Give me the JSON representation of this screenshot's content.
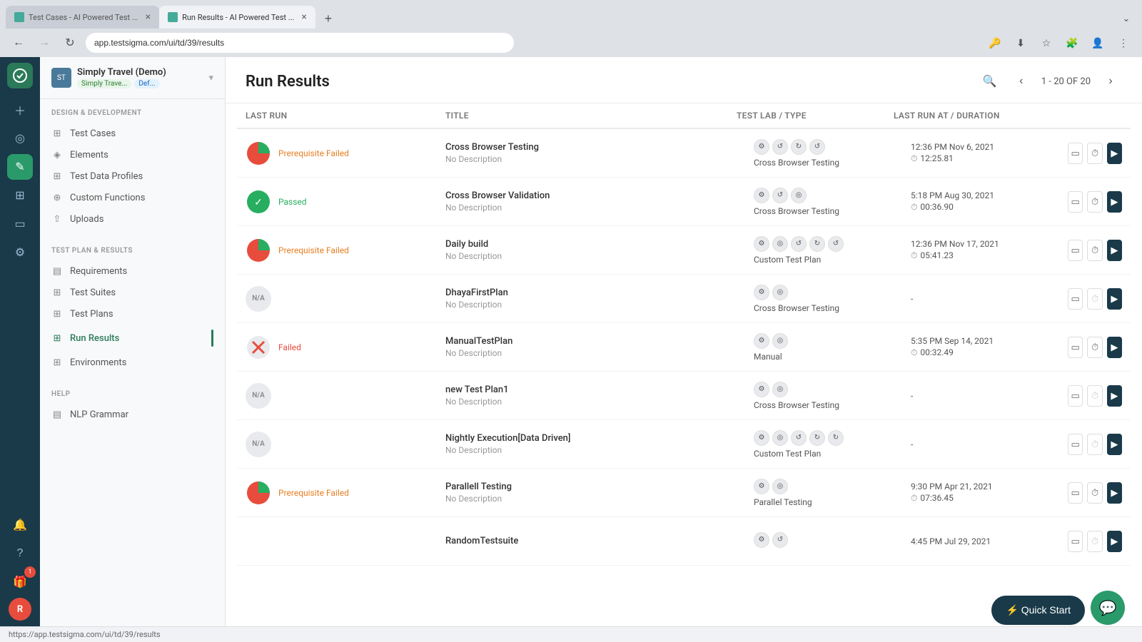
{
  "browser": {
    "tabs": [
      {
        "id": "tab1",
        "label": "Test Cases - AI Powered Test ...",
        "active": false,
        "icon_color": "#4a9a6a"
      },
      {
        "id": "tab2",
        "label": "Run Results - AI Powered Test ...",
        "active": true,
        "icon_color": "#4a9a6a"
      }
    ],
    "new_tab_label": "+",
    "address": "app.testsigma.com/ui/td/39/results",
    "back_disabled": false,
    "forward_disabled": true
  },
  "rail": {
    "logo": "T",
    "buttons": [
      {
        "id": "add",
        "icon": "➕",
        "active": false
      },
      {
        "id": "eye",
        "icon": "◎",
        "active": false
      },
      {
        "id": "edit",
        "icon": "✏",
        "active": true,
        "style": "green"
      },
      {
        "id": "briefcase",
        "icon": "💼",
        "active": false
      },
      {
        "id": "monitor",
        "icon": "⬜",
        "active": false
      },
      {
        "id": "settings",
        "icon": "⚙",
        "active": false
      },
      {
        "id": "bell",
        "icon": "🔔",
        "active": false
      },
      {
        "id": "help",
        "icon": "❓",
        "active": false
      },
      {
        "id": "gift",
        "icon": "🎁",
        "badge": "1"
      }
    ],
    "avatar_label": "R"
  },
  "sidebar": {
    "org_name": "Simply Travel (Demo)",
    "org_sub1": "Simply Trave...",
    "org_sub2": "Def...",
    "sections": [
      {
        "label": "DESIGN & DEVELOPMENT",
        "items": [
          {
            "id": "test-cases",
            "label": "Test Cases",
            "icon": "▦",
            "active": false
          },
          {
            "id": "elements",
            "label": "Elements",
            "icon": "◈",
            "active": false
          },
          {
            "id": "test-data-profiles",
            "label": "Test Data Profiles",
            "icon": "⊞",
            "active": false
          },
          {
            "id": "custom-functions",
            "label": "Custom Functions",
            "icon": "⊕",
            "active": false
          },
          {
            "id": "uploads",
            "label": "Uploads",
            "icon": "⇧",
            "active": false
          }
        ]
      },
      {
        "label": "TEST PLAN & RESULTS",
        "items": [
          {
            "id": "requirements",
            "label": "Requirements",
            "icon": "▤",
            "active": false
          },
          {
            "id": "test-suites",
            "label": "Test Suites",
            "icon": "▦",
            "active": false
          },
          {
            "id": "test-plans",
            "label": "Test Plans",
            "icon": "▦",
            "active": false
          },
          {
            "id": "run-results",
            "label": "Run Results",
            "icon": "▦",
            "active": true
          },
          {
            "id": "environments",
            "label": "Environments",
            "icon": "▦",
            "active": false
          }
        ]
      },
      {
        "label": "HELP",
        "items": [
          {
            "id": "nlp-grammar",
            "label": "NLP Grammar",
            "icon": "▤",
            "active": false
          }
        ]
      }
    ]
  },
  "main": {
    "title": "Run Results",
    "pagination": "1 - 20 OF 20",
    "table_headers": [
      "Last Run",
      "Title",
      "Test Lab / Type",
      "Last Run At / Duration",
      ""
    ],
    "rows": [
      {
        "id": "row1",
        "status_type": "pie",
        "status_label": "Prerequisite Failed",
        "status_color": "#e67e22",
        "title": "Cross Browser Testing",
        "description": "No Description",
        "lab_icons": [
          "⚙",
          "↺",
          "↻",
          "↺"
        ],
        "lab_type": "Cross Browser Testing",
        "time_date": "12:36 PM Nov 6, 2021",
        "duration": "12:25.81",
        "has_duration": true
      },
      {
        "id": "row2",
        "status_type": "passed",
        "status_label": "Passed",
        "status_color": "#27ae60",
        "title": "Cross Browser Validation",
        "description": "No Description",
        "lab_icons": [
          "⚙",
          "↺",
          "◎"
        ],
        "lab_type": "Cross Browser Testing",
        "time_date": "5:18 PM Aug 30, 2021",
        "duration": "00:36.90",
        "has_duration": true
      },
      {
        "id": "row3",
        "status_type": "pie",
        "status_label": "Prerequisite Failed",
        "status_color": "#e67e22",
        "title": "Daily build",
        "description": "No Description",
        "lab_icons": [
          "⚙",
          "◎",
          "↺",
          "↻",
          "↺"
        ],
        "lab_type": "Custom Test Plan",
        "time_date": "12:36 PM Nov 17, 2021",
        "duration": "05:41.23",
        "has_duration": true
      },
      {
        "id": "row4",
        "status_type": "na",
        "status_label": "N/A",
        "status_color": "#aaa",
        "title": "DhayaFirstPlan",
        "description": "No Description",
        "lab_icons": [
          "⚙",
          "◎"
        ],
        "lab_type": "Cross Browser Testing",
        "time_date": "-",
        "duration": "",
        "has_duration": false
      },
      {
        "id": "row5",
        "status_type": "failed",
        "status_label": "Failed",
        "status_color": "#e74c3c",
        "title": "ManualTestPlan",
        "description": "No Description",
        "lab_icons": [
          "⚙",
          "◎"
        ],
        "lab_type": "Manual",
        "time_date": "5:35 PM Sep 14, 2021",
        "duration": "00:32.49",
        "has_duration": true
      },
      {
        "id": "row6",
        "status_type": "na",
        "status_label": "N/A",
        "status_color": "#aaa",
        "title": "new Test Plan1",
        "description": "No Description",
        "lab_icons": [
          "⚙",
          "◎"
        ],
        "lab_type": "Cross Browser Testing",
        "time_date": "-",
        "duration": "",
        "has_duration": false
      },
      {
        "id": "row7",
        "status_type": "na",
        "status_label": "N/A",
        "status_color": "#aaa",
        "title": "Nightly Execution[Data Driven]",
        "description": "No Description",
        "lab_icons": [
          "⚙",
          "◎",
          "↺",
          "↻",
          "↻"
        ],
        "lab_type": "Custom Test Plan",
        "time_date": "-",
        "duration": "",
        "has_duration": false
      },
      {
        "id": "row8",
        "status_type": "pie",
        "status_label": "Prerequisite Failed",
        "status_color": "#e67e22",
        "title": "Parallell Testing",
        "description": "No Description",
        "lab_icons": [
          "⚙",
          "◎"
        ],
        "lab_type": "Parallel Testing",
        "time_date": "9:30 PM Apr 21, 2021",
        "duration": "07:36.45",
        "has_duration": true
      },
      {
        "id": "row9",
        "status_type": "icons_only",
        "status_label": "",
        "status_color": "#aaa",
        "title": "RandomTestsuite",
        "description": "",
        "lab_icons": [
          "⚙",
          "↺"
        ],
        "lab_type": "",
        "time_date": "4:45 PM Jul 29, 2021",
        "duration": "",
        "has_duration": false
      }
    ]
  },
  "quick_start": {
    "label": "⚡ Quick Start"
  },
  "status_bar": {
    "url": "https://app.testsigma.com/ui/td/39/results"
  }
}
